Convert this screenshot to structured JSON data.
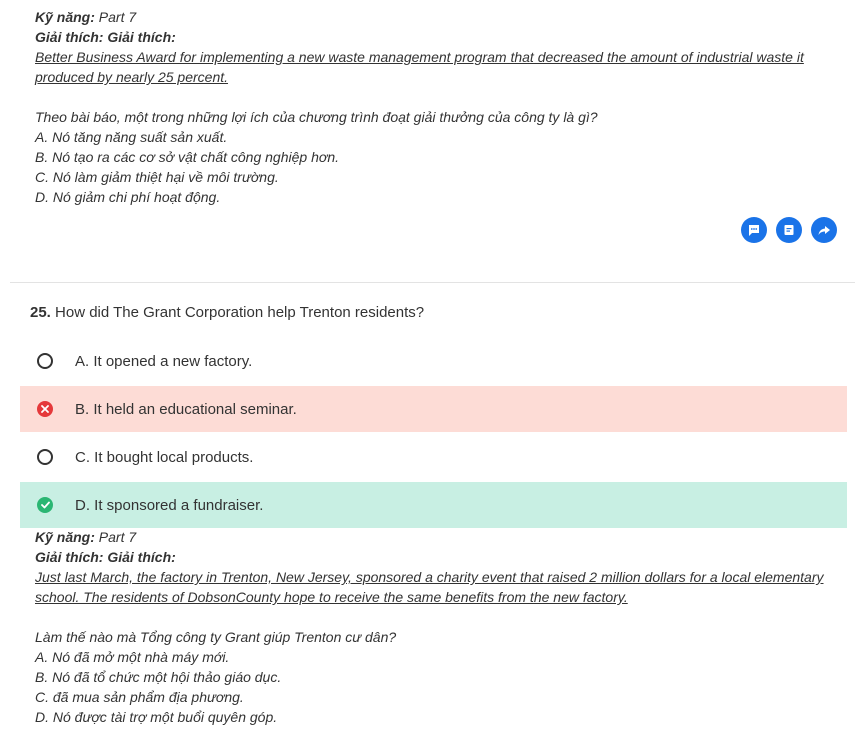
{
  "colors": {
    "action_blue": "#1a73e8",
    "wrong_bg": "#fddcd6",
    "correct_bg": "#c8efe3",
    "wrong_icon": "#e5393b",
    "correct_icon": "#2bb673"
  },
  "prev_explanation": {
    "skill_label": "Kỹ năng:",
    "skill_value": "Part 7",
    "explain_label": "Giải thích: Giải thích:",
    "quote_line1": "Better Business Award for implementing a new waste management program that decreased the amount of industrial waste it",
    "quote_line2": "produced by nearly 25 percent.",
    "question_vi": "Theo bài báo, một trong những lợi ích của chương trình đoạt giải thưởng của công ty là gì?",
    "options_vi": [
      "A. Nó tăng năng suất sản xuất.",
      "B. Nó tạo ra các cơ sở vật chất công nghiệp hơn.",
      "C. Nó làm giảm thiệt hại về môi trường.",
      "D. Nó giảm chi phí hoạt động."
    ]
  },
  "actions": [
    {
      "icon": "comment-icon"
    },
    {
      "icon": "note-icon"
    },
    {
      "icon": "share-icon"
    }
  ],
  "question": {
    "number": "25.",
    "text": "How did The Grant Corporation help Trenton residents?",
    "options": [
      {
        "label": "A. It opened a new factory.",
        "state": "unselected"
      },
      {
        "label": "B. It held an educational seminar.",
        "state": "wrong"
      },
      {
        "label": "C. It bought local products.",
        "state": "unselected"
      },
      {
        "label": "D. It sponsored a fundraiser.",
        "state": "correct"
      }
    ]
  },
  "explanation": {
    "skill_label": "Kỹ năng:",
    "skill_value": "Part 7",
    "explain_label": "Giải thích: Giải thích:",
    "quote_line1": "Just last March, the factory in Trenton, New Jersey, sponsored a charity event that raised 2 million dollars for a local elementary",
    "quote_line2": "school. The residents of DobsonCounty hope to receive the same benefits from the new factory.",
    "question_vi": "Làm thế nào mà Tổng công ty Grant giúp Trenton cư dân?",
    "options_vi": [
      "A. Nó đã mở một nhà máy mới.",
      "B. Nó đã tổ chức một hội thảo giáo dục.",
      "C. đã mua sản phẩm địa phương.",
      "D. Nó được tài trợ một buổi quyên góp."
    ]
  }
}
